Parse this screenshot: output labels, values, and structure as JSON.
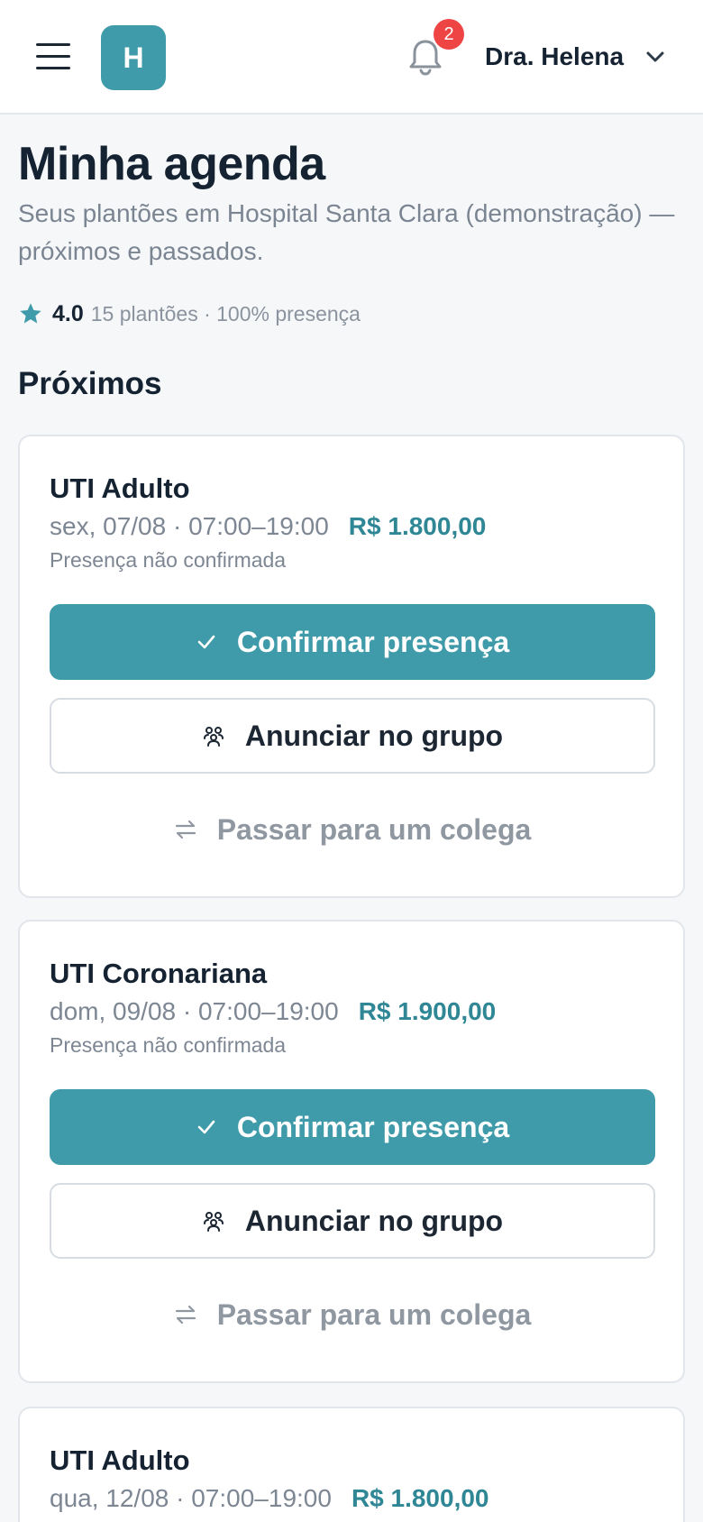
{
  "header": {
    "logo_letter": "H",
    "notifications_count": "2",
    "user_name": "Dra. Helena"
  },
  "page": {
    "title": "Minha agenda",
    "subtitle": "Seus plantões em Hospital Santa Clara (demonstração) — próximos e passados.",
    "rating": "4.0",
    "stats_text": "15 plantões · 100% presença",
    "section_upcoming": "Próximos"
  },
  "shifts": [
    {
      "unit": "UTI Adulto",
      "date_time": "sex, 07/08 · 07:00–19:00",
      "price": "R$ 1.800,00",
      "status": "Presença não confirmada",
      "confirm_label": "Confirmar presença",
      "announce_label": "Anunciar no grupo",
      "transfer_label": "Passar para um colega"
    },
    {
      "unit": "UTI Coronariana",
      "date_time": "dom, 09/08 · 07:00–19:00",
      "price": "R$ 1.900,00",
      "status": "Presença não confirmada",
      "confirm_label": "Confirmar presença",
      "announce_label": "Anunciar no grupo",
      "transfer_label": "Passar para um colega"
    },
    {
      "unit": "UTI Adulto",
      "date_time": "qua, 12/08 · 07:00–19:00",
      "price": "R$ 1.800,00"
    }
  ],
  "colors": {
    "accent": "#3f9ba9",
    "price": "#2f8796",
    "badge": "#ef4444",
    "text": "#152232",
    "muted": "#7d8693"
  },
  "icons": {
    "menu": "hamburger-icon",
    "bell": "bell-icon",
    "dropdown": "chevron-down-icon",
    "rating": "star-icon",
    "confirm": "check-icon",
    "announce": "group-icon",
    "transfer": "swap-icon"
  }
}
